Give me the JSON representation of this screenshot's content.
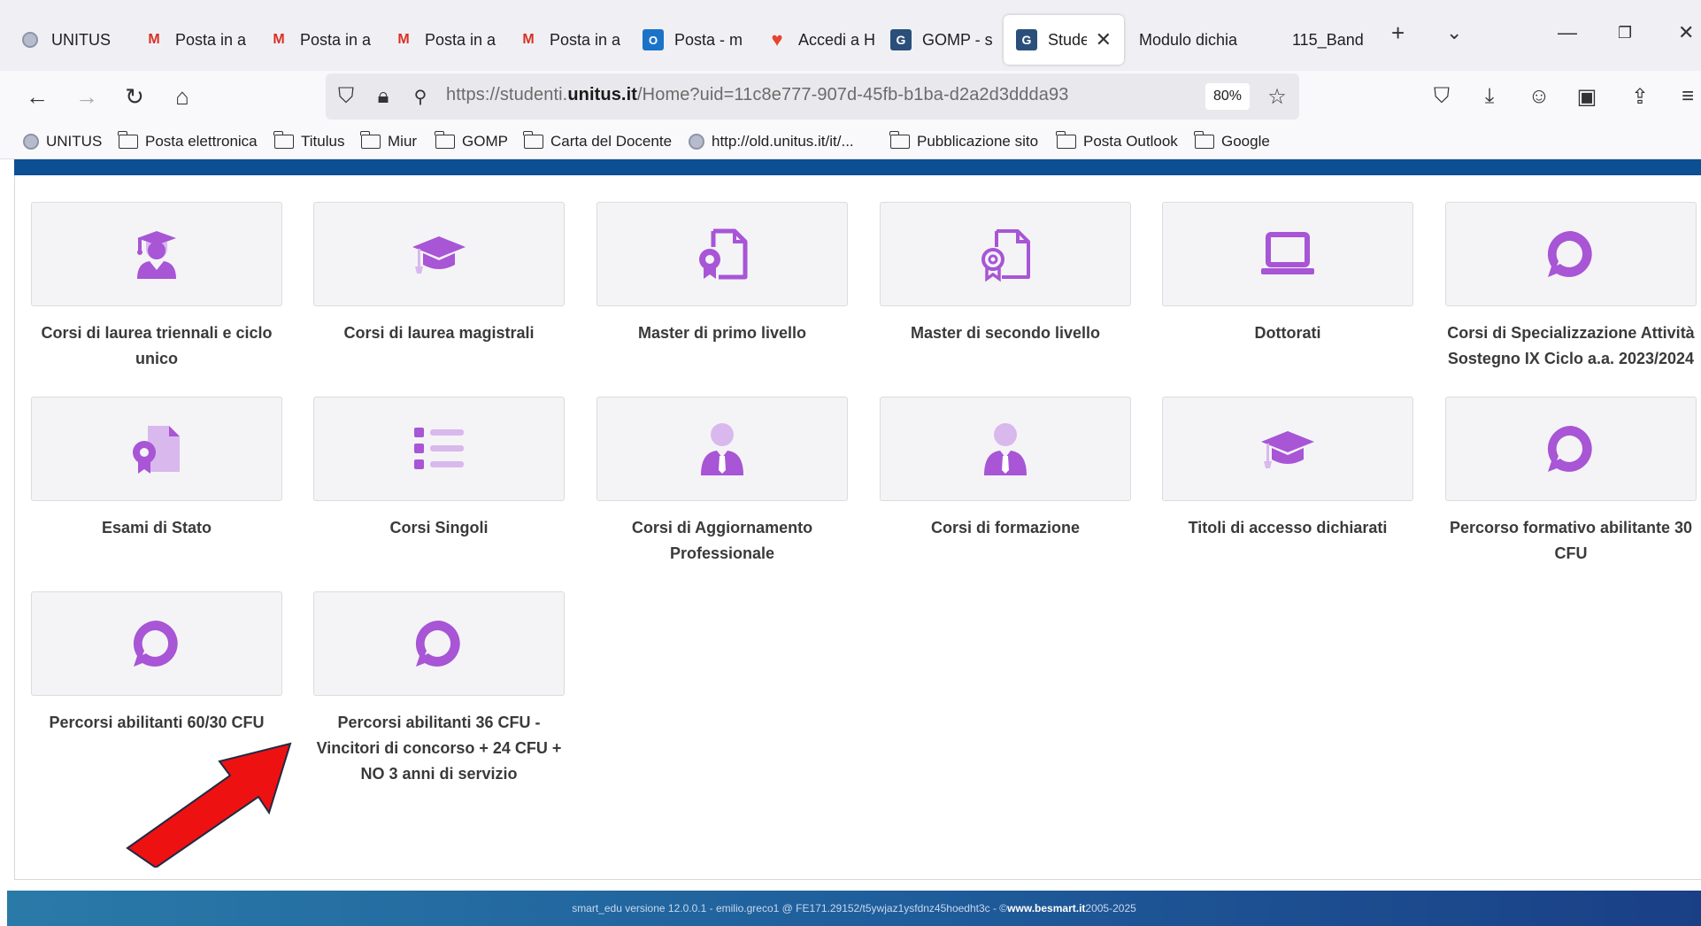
{
  "browser": {
    "tabs": [
      {
        "label": "UNITUS",
        "icon": "unitus-logo-icon"
      },
      {
        "label": "Posta in a",
        "icon": "gmail-icon"
      },
      {
        "label": "Posta in a",
        "icon": "gmail-icon"
      },
      {
        "label": "Posta in a",
        "icon": "gmail-icon"
      },
      {
        "label": "Posta in a",
        "icon": "gmail-icon"
      },
      {
        "label": "Posta - m",
        "icon": "outlook-icon"
      },
      {
        "label": "Accedi a H",
        "icon": "hubspot-icon"
      },
      {
        "label": "GOMP - s",
        "icon": "gomp-icon"
      },
      {
        "label": "Studen",
        "icon": "gomp-icon"
      },
      {
        "label": "Modulo dichia",
        "icon": ""
      },
      {
        "label": "115_Band",
        "icon": ""
      }
    ],
    "url_prefix": "https://studenti.",
    "url_domain": "unitus.it",
    "url_path": "/Home?uid=11c8e777-907d-45fb-b1ba-d2a2d3ddda93",
    "zoom": "80%",
    "bookmarks": [
      "UNITUS",
      "Posta elettronica",
      "Titulus",
      "Miur",
      "GOMP",
      "Carta del Docente",
      "http://old.unitus.it/it/...",
      "Pubblicazione sito",
      "Posta Outlook",
      "Google"
    ]
  },
  "tiles": [
    {
      "label_line1": "Corsi di laurea triennali e ciclo",
      "label_line2": "unico",
      "icon": "graduate-student-icon"
    },
    {
      "label_line1": "Corsi di laurea magistrali",
      "label_line2": "",
      "icon": "graduation-cap-icon"
    },
    {
      "label_line1": "Master di primo livello",
      "label_line2": "",
      "icon": "certificate-file-icon"
    },
    {
      "label_line1": "Master di secondo livello",
      "label_line2": "",
      "icon": "certificate-file-outline-icon"
    },
    {
      "label_line1": "Dottorati",
      "label_line2": "",
      "icon": "laptop-icon"
    },
    {
      "label_line1": "Corsi di Specializzazione Attività",
      "label_line2": "Sostegno IX Ciclo a.a. 2023/2024",
      "icon": "chat-bubble-icon"
    },
    {
      "label_line1": "Esami di Stato",
      "label_line2": "",
      "icon": "certificate-file-icon"
    },
    {
      "label_line1": "Corsi Singoli",
      "label_line2": "",
      "icon": "list-icon"
    },
    {
      "label_line1": "Corsi di Aggiornamento",
      "label_line2": "Professionale",
      "icon": "person-tie-icon"
    },
    {
      "label_line1": "Corsi di formazione",
      "label_line2": "",
      "icon": "person-tie-icon"
    },
    {
      "label_line1": "Titoli di accesso dichiarati",
      "label_line2": "",
      "icon": "graduation-cap-icon"
    },
    {
      "label_line1": "Percorso formativo abilitante 30",
      "label_line2": "CFU",
      "icon": "chat-bubble-icon"
    },
    {
      "label_line1": "Percorsi abilitanti 60/30 CFU",
      "label_line2": "",
      "icon": "chat-bubble-icon"
    },
    {
      "label_line1": "Percorsi abilitanti 36 CFU -",
      "label_line2": "Vincitori di concorso + 24 CFU +",
      "label_line3": "NO 3 anni di servizio",
      "icon": "chat-bubble-icon"
    }
  ],
  "footer": {
    "text": "smart_edu versione 12.0.0.1 - emilio.greco1 @ FE171.29152/t5ywjaz1ysfdnz45hoedht3c - © ",
    "link": "www.besmart.it",
    "years": " 2005-2025"
  },
  "colors": {
    "accent_purple": "#a855d6",
    "accent_purple_light": "#d9b8ee",
    "header_blue": "#0d4f93",
    "annotation_red": "#ee1111"
  }
}
